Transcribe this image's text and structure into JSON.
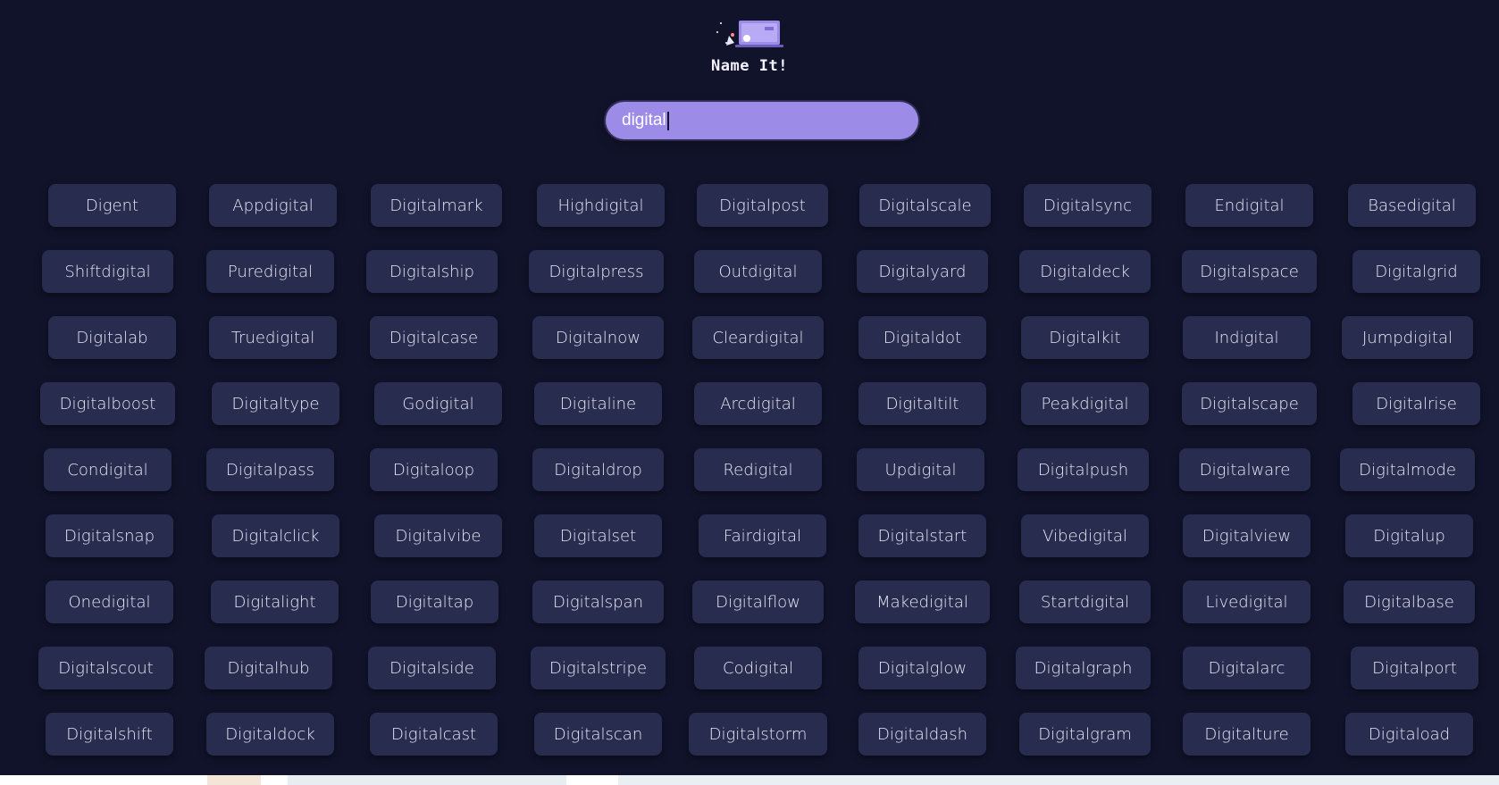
{
  "app": {
    "title": "Name It!",
    "logo_icon": "laptop-logo-icon"
  },
  "search": {
    "value": "digital",
    "placeholder": ""
  },
  "colors": {
    "background": "#11132b",
    "chip": "#282c4e",
    "accent": "#9c8ce8"
  },
  "names": [
    [
      "Digent",
      "Appdigital",
      "Digitalmark",
      "Highdigital",
      "Digitalpost",
      "Digitalscale",
      "Digitalsync",
      "Endigital",
      "Basedigital"
    ],
    [
      "Shiftdigital",
      "Puredigital",
      "Digitalship",
      "Digitalpress",
      "Outdigital",
      "Digitalyard",
      "Digitaldeck",
      "Digitalspace",
      "Digitalgrid"
    ],
    [
      "Digitalab",
      "Truedigital",
      "Digitalcase",
      "Digitalnow",
      "Cleardigital",
      "Digitaldot",
      "Digitalkit",
      "Indigital",
      "Jumpdigital"
    ],
    [
      "Digitalboost",
      "Digitaltype",
      "Godigital",
      "Digitaline",
      "Arcdigital",
      "Digitaltilt",
      "Peakdigital",
      "Digitalscape",
      "Digitalrise"
    ],
    [
      "Condigital",
      "Digitalpass",
      "Digitaloop",
      "Digitaldrop",
      "Redigital",
      "Updigital",
      "Digitalpush",
      "Digitalware",
      "Digitalmode"
    ],
    [
      "Digitalsnap",
      "Digitalclick",
      "Digitalvibe",
      "Digitalset",
      "Fairdigital",
      "Digitalstart",
      "Vibedigital",
      "Digitalview",
      "Digitalup"
    ],
    [
      "Onedigital",
      "Digitalight",
      "Digitaltap",
      "Digitalspan",
      "Digitalflow",
      "Makedigital",
      "Startdigital",
      "Livedigital",
      "Digitalbase"
    ],
    [
      "Digitalscout",
      "Digitalhub",
      "Digitalside",
      "Digitalstripe",
      "Codigital",
      "Digitalglow",
      "Digitalgraph",
      "Digitalarc",
      "Digitalport"
    ],
    [
      "Digitalshift",
      "Digitaldock",
      "Digitalcast",
      "Digitalscan",
      "Digitalstorm",
      "Digitaldash",
      "Digitalgram",
      "Digitalture",
      "Digitaload"
    ]
  ]
}
